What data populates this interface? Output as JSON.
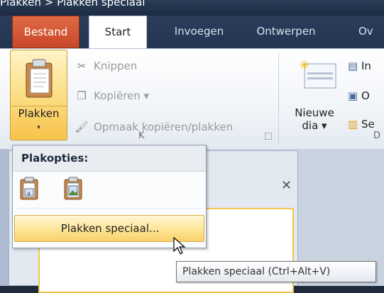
{
  "window": {
    "caption": "Plakken > Plakken speciaal"
  },
  "tabs": [
    {
      "label": "Bestand"
    },
    {
      "label": "Start"
    },
    {
      "label": "Invoegen"
    },
    {
      "label": "Ontwerpen"
    },
    {
      "label": "Ov"
    }
  ],
  "clipboard": {
    "paste_label": "Plakken",
    "paste_arrow": "▾",
    "cut_label": "Knippen",
    "copy_label": "Kopiëren ▾",
    "format_painter_label": "Opmaak kopiëren/plakken",
    "group_label": "K"
  },
  "slides": {
    "new_slide_line1": "Nieuwe",
    "new_slide_line2": "dia ▾",
    "layout_label": "In",
    "reset_label": "O",
    "section_label": "Se",
    "group_label": "D"
  },
  "paste_menu": {
    "header": "Plakopties:",
    "options": [
      "use-destination-theme-icon",
      "picture-icon"
    ],
    "special_label": "Plakken speciaal..."
  },
  "tooltip": {
    "text": "Plakken speciaal (Ctrl+Alt+V)"
  },
  "panel": {
    "close": "✕"
  },
  "colors": {
    "accent": "#f7c24a",
    "file_tab": "#c8472a",
    "tab_bg": "#243552"
  }
}
